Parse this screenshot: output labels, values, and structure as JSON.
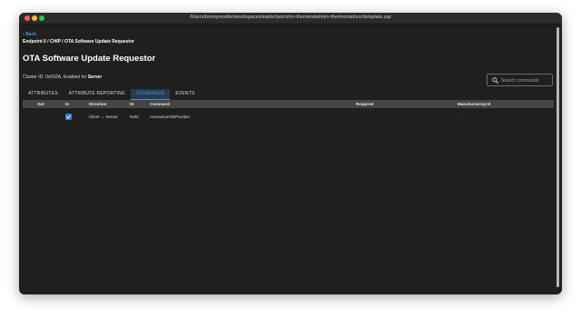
{
  "window": {
    "title": "/Users/bennynestler/workspaces/matter/poc/etrv-thermostat/etrv-thermostat/src/template.zap"
  },
  "nav": {
    "back_label": "Back",
    "breadcrumb": "Endpoint 0  /  CHIP  /  OTA Software Update Requestor"
  },
  "page": {
    "title": "OTA Software Update Requestor",
    "cluster_prefix": "Cluster ID: 0x002A, Enabled for ",
    "cluster_side": "Server"
  },
  "search": {
    "placeholder": "Search commands",
    "value": ""
  },
  "tabs": [
    {
      "label": "ATTRIBUTES",
      "active": false
    },
    {
      "label": "ATTRIBUTE REPORTING",
      "active": false
    },
    {
      "label": "COMMANDS",
      "active": true
    },
    {
      "label": "EVENTS",
      "active": false
    }
  ],
  "table": {
    "columns": [
      "Out",
      "In",
      "Direction",
      "ID",
      "Command",
      "Required",
      "Manufacturing Id"
    ],
    "rows": [
      {
        "out": false,
        "in": true,
        "direction": "Client → Server",
        "id": "0x00",
        "command": "AnnounceOtaProvider",
        "required": "",
        "manufacturing_id": "-"
      }
    ]
  },
  "colors": {
    "accent": "#4a90e2",
    "checkbox": "#2f7fd8",
    "window_bg": "#1f1f1d"
  },
  "icons": {
    "search": "search-icon",
    "checkbox": "check-icon"
  }
}
